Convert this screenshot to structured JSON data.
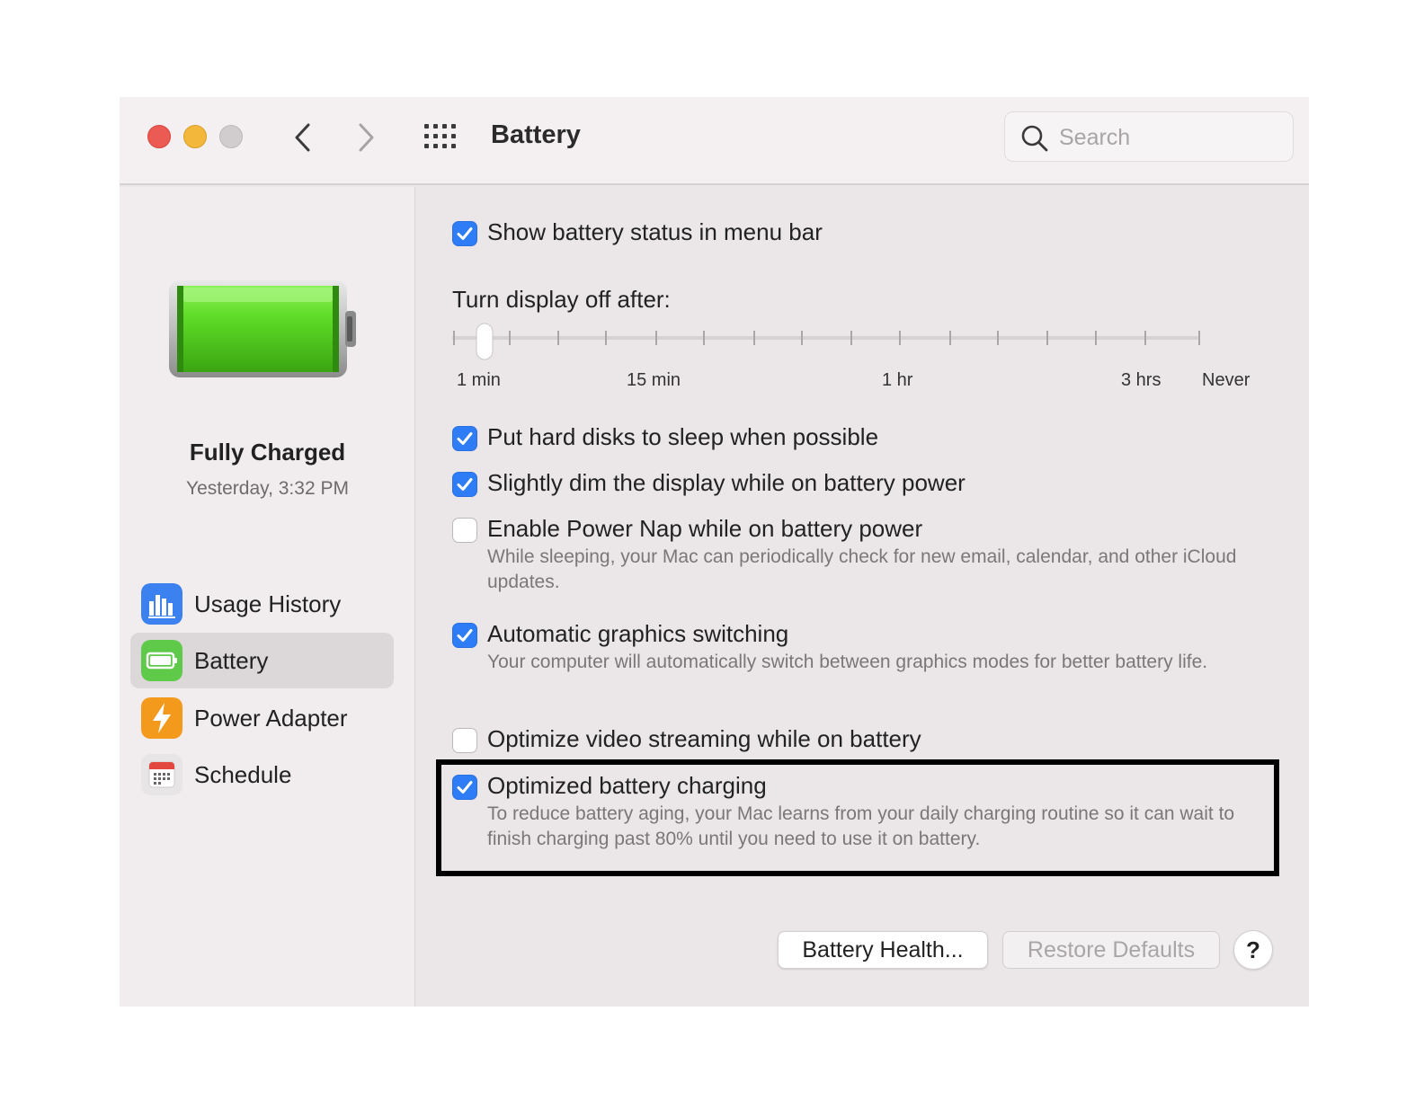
{
  "window": {
    "title": "Battery",
    "search_placeholder": "Search"
  },
  "sidebar": {
    "status_title": "Fully Charged",
    "status_time": "Yesterday, 3:32 PM",
    "items": [
      {
        "label": "Usage History",
        "icon": "bar-chart-icon",
        "selected": false
      },
      {
        "label": "Battery",
        "icon": "battery-icon",
        "selected": true
      },
      {
        "label": "Power Adapter",
        "icon": "lightning-icon",
        "selected": false
      },
      {
        "label": "Schedule",
        "icon": "calendar-icon",
        "selected": false
      }
    ]
  },
  "settings": {
    "show_status": {
      "label": "Show battery status in menu bar",
      "checked": true
    },
    "display_off": {
      "label": "Turn display off after:",
      "tick_labels": [
        "1 min",
        "15 min",
        "1 hr",
        "3 hrs",
        "Never"
      ],
      "value": "1 min"
    },
    "hard_disks": {
      "label": "Put hard disks to sleep when possible",
      "checked": true
    },
    "dim_display": {
      "label": "Slightly dim the display while on battery power",
      "checked": true
    },
    "power_nap": {
      "label": "Enable Power Nap while on battery power",
      "description": "While sleeping, your Mac can periodically check for new email, calendar, and other iCloud updates.",
      "checked": false
    },
    "graphics_switching": {
      "label": "Automatic graphics switching",
      "description": "Your computer will automatically switch between graphics modes for better battery life.",
      "checked": true
    },
    "video_streaming": {
      "label": "Optimize video streaming while on battery",
      "checked": false
    },
    "optimized_charging": {
      "label": "Optimized battery charging",
      "description": "To reduce battery aging, your Mac learns from your daily charging routine so it can wait to finish charging past 80% until you need to use it on battery.",
      "checked": true
    }
  },
  "buttons": {
    "battery_health": "Battery Health...",
    "restore_defaults": "Restore Defaults",
    "help": "?"
  },
  "colors": {
    "accent": "#2f7df6",
    "close": "#ec5a54",
    "minimize": "#f3b83b",
    "zoom": "#d1cdcf",
    "highlight_border": "#000000"
  }
}
